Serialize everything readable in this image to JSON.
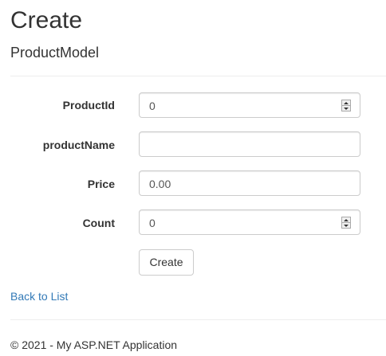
{
  "page": {
    "title": "Create",
    "model_title": "ProductModel"
  },
  "form": {
    "fields": [
      {
        "label": "ProductId",
        "value": "0",
        "type": "number"
      },
      {
        "label": "productName",
        "value": "",
        "type": "text"
      },
      {
        "label": "Price",
        "value": "0.00",
        "type": "text"
      },
      {
        "label": "Count",
        "value": "0",
        "type": "number"
      }
    ],
    "submit_label": "Create"
  },
  "links": {
    "back_label": "Back to List"
  },
  "footer": {
    "text": "© 2021 - My ASP.NET Application"
  },
  "colors": {
    "link": "#337ab7",
    "text": "#333333",
    "input_border": "#cccccc"
  }
}
